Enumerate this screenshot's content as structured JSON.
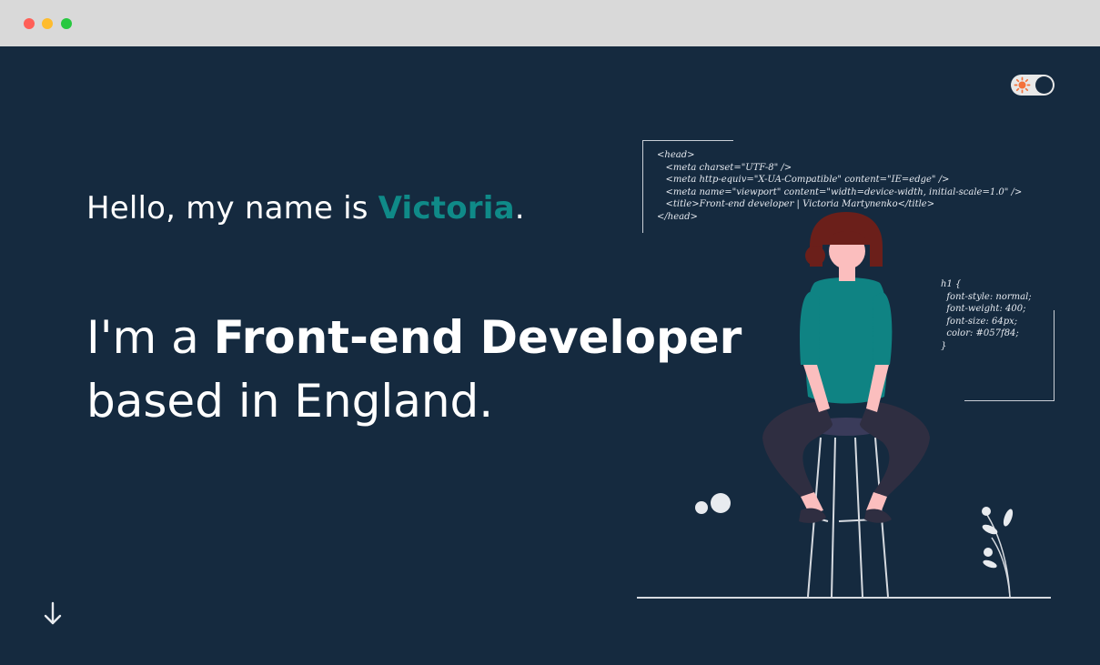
{
  "browser": {
    "controls": [
      "close",
      "minimize",
      "maximize"
    ]
  },
  "theme_toggle": {
    "icon": "sun-icon"
  },
  "hero": {
    "greeting_prefix": "Hello, my name is ",
    "name": "Victoria",
    "greeting_suffix": ".",
    "role_prefix": "I'm a ",
    "role_title": "Front-end Developer",
    "role_location": "based in England."
  },
  "code_snippets": {
    "html_head": "<head>\n   <meta charset=\"UTF-8\" />\n   <meta http-equiv=\"X-UA-Compatible\" content=\"IE=edge\" />\n   <meta name=\"viewport\" content=\"width=device-width, initial-scale=1.0\" />\n   <title>Front-end developer | Victoria Martynenko</title>\n</head>",
    "css_h1": "h1 {\n  font-style: normal;\n  font-weight: 400;\n  font-size: 64px;\n  color: #057f84;\n}"
  },
  "scroll_down": {
    "icon": "arrow-down-icon"
  },
  "colors": {
    "background": "#152a3f",
    "accent": "#0f8a88",
    "text": "#ffffff"
  }
}
